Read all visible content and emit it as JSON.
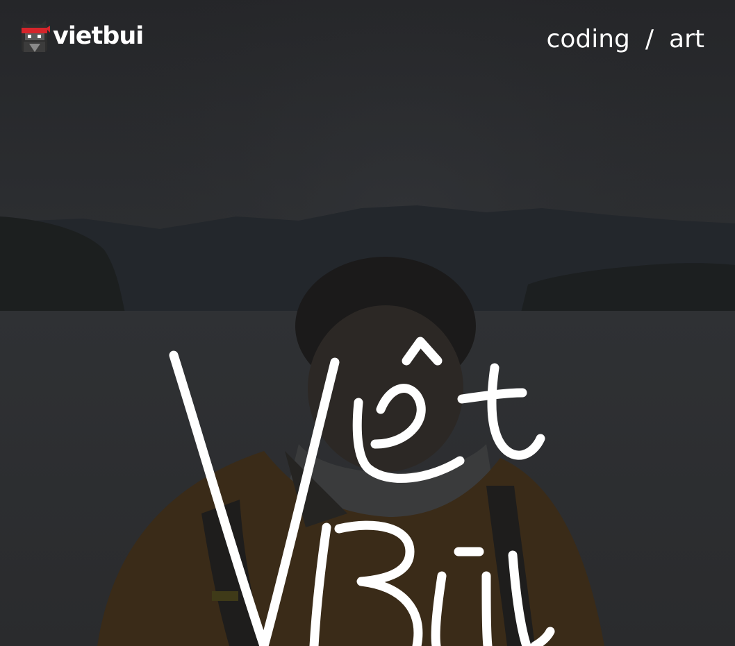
{
  "header": {
    "logo_text": "vietbui",
    "logo_icon": "ninja-cat-icon"
  },
  "nav": {
    "items": [
      {
        "label": "coding"
      },
      {
        "label": "art"
      }
    ],
    "separator": "/"
  },
  "hero": {
    "background": "dark-overlay-lake-photo",
    "handwritten_name": "Việt Bùi"
  },
  "colors": {
    "overlay": "#2b2c2e",
    "text": "#ffffff",
    "headband": "#d6252b"
  }
}
